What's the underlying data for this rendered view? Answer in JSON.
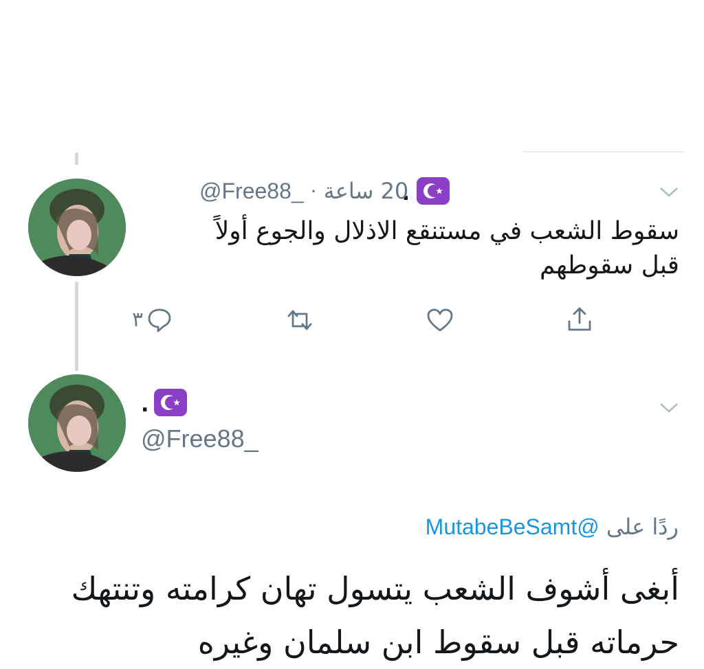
{
  "tweet1": {
    "handle": "@Free88_",
    "separator": "·",
    "time": "20 ساعة",
    "text_line1": "سقوط الشعب في مستنقع الاذلال والجوع أولاً",
    "text_line2": "قبل سقوطهم",
    "reply_count": "٣",
    "icons": [
      "reply-icon",
      "retweet-icon",
      "like-icon",
      "share-icon"
    ]
  },
  "tweet2": {
    "handle": "@Free88_",
    "replying_to_label": "ردًا على",
    "replying_to_handle": "@MutabeBeSamt",
    "text_line1": "أبغى أشوف الشعب يتسول تهان كرامته وتنتهك",
    "text_line2": "حرماته قبل سقوط ابن سلمان وغيره"
  },
  "colors": {
    "badge": "#8a3fc6",
    "muted": "#657786",
    "link": "#1b95e0",
    "thread_line": "#d3d8dc"
  }
}
